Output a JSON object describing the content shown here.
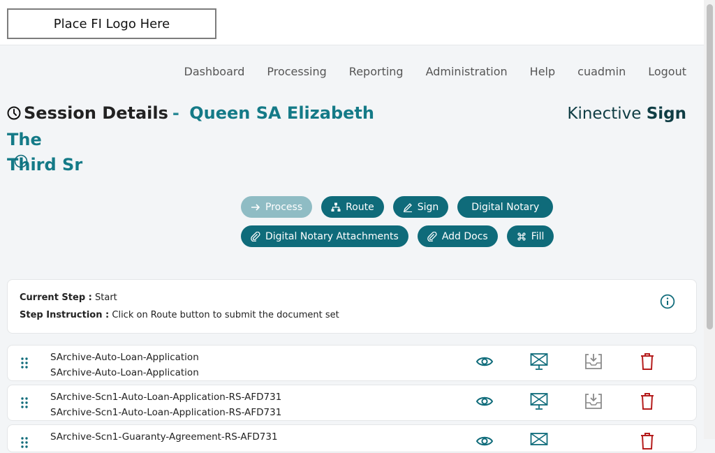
{
  "header": {
    "logo_text": "Place FI Logo Here"
  },
  "nav": [
    "Dashboard",
    "Processing",
    "Reporting",
    "Administration",
    "Help",
    "cuadmin",
    "Logout"
  ],
  "title": {
    "label": "Session Details",
    "separator": "-",
    "name_line1": "Queen SA Elizabeth The",
    "name_line2": "Third Sr"
  },
  "brand": {
    "part1": "Kinective",
    "part2": "Sign"
  },
  "buttons": {
    "process": "Process",
    "route": "Route",
    "sign": "Sign",
    "digital_notary": "Digital Notary",
    "dn_attachments": "Digital Notary Attachments",
    "add_docs": "Add Docs",
    "fill": "Fill"
  },
  "step": {
    "current_label": "Current Step :",
    "current_value": "Start",
    "instruction_label": "Step Instruction :",
    "instruction_value": "Click on Route button to submit the document set"
  },
  "documents": [
    {
      "name": "SArchive-Auto-Loan-Application",
      "subname": "SArchive-Auto-Loan-Application"
    },
    {
      "name": "SArchive-Scn1-Auto-Loan-Application-RS-AFD731",
      "subname": "SArchive-Scn1-Auto-Loan-Application-RS-AFD731"
    },
    {
      "name": "SArchive-Scn1-Guaranty-Agreement-RS-AFD731",
      "subname": ""
    }
  ],
  "colors": {
    "teal": "#0f6b7a",
    "teal_disabled": "#8fbcc4",
    "danger": "#b51c1c",
    "muted_icon": "#8a8a8a"
  }
}
